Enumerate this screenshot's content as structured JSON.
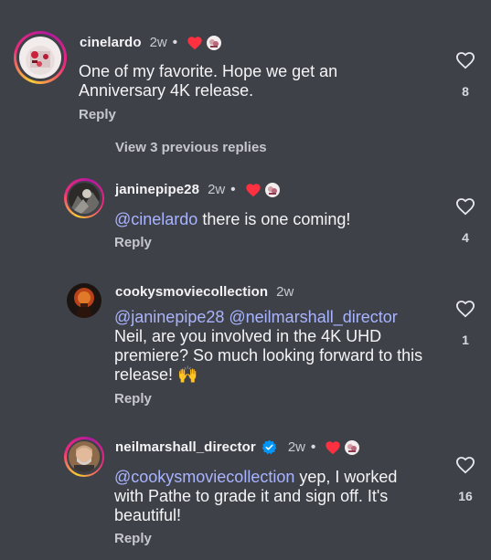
{
  "comments": [
    {
      "username": "cinelardo",
      "time": "2w",
      "dot": "•",
      "text": "One of my favorite.  Hope we get an Anniversary 4K release.",
      "reply_label": "Reply",
      "likes": "8"
    },
    {
      "username": "janinepipe28",
      "time": "2w",
      "dot": "•",
      "mention": "@cinelardo",
      "text": " there is one coming!",
      "reply_label": "Reply",
      "likes": "4"
    },
    {
      "username": "cookysmoviecollection",
      "time": "2w",
      "mention1": "@janinepipe28",
      "mention2": "@neilmarshall_director",
      "text": "Neil, are you involved in the 4K UHD premiere? So much looking forward to this release! 🙌",
      "reply_label": "Reply",
      "likes": "1"
    },
    {
      "username": "neilmarshall_director",
      "time": "2w",
      "dot": "•",
      "mention": "@cookysmoviecollection",
      "text": " yep, I worked with Pathe to grade it and sign off. It's beautiful!",
      "reply_label": "Reply",
      "likes": "16"
    }
  ],
  "view_previous": "View 3 previous replies",
  "colors": {
    "background": "#3f4148",
    "mention": "#a9b4ff",
    "creator_heart": "#ff3040",
    "verified": "#0095f6"
  },
  "icons": [
    "heart-outline-icon",
    "creator-heart-icon",
    "verified-badge-icon"
  ]
}
